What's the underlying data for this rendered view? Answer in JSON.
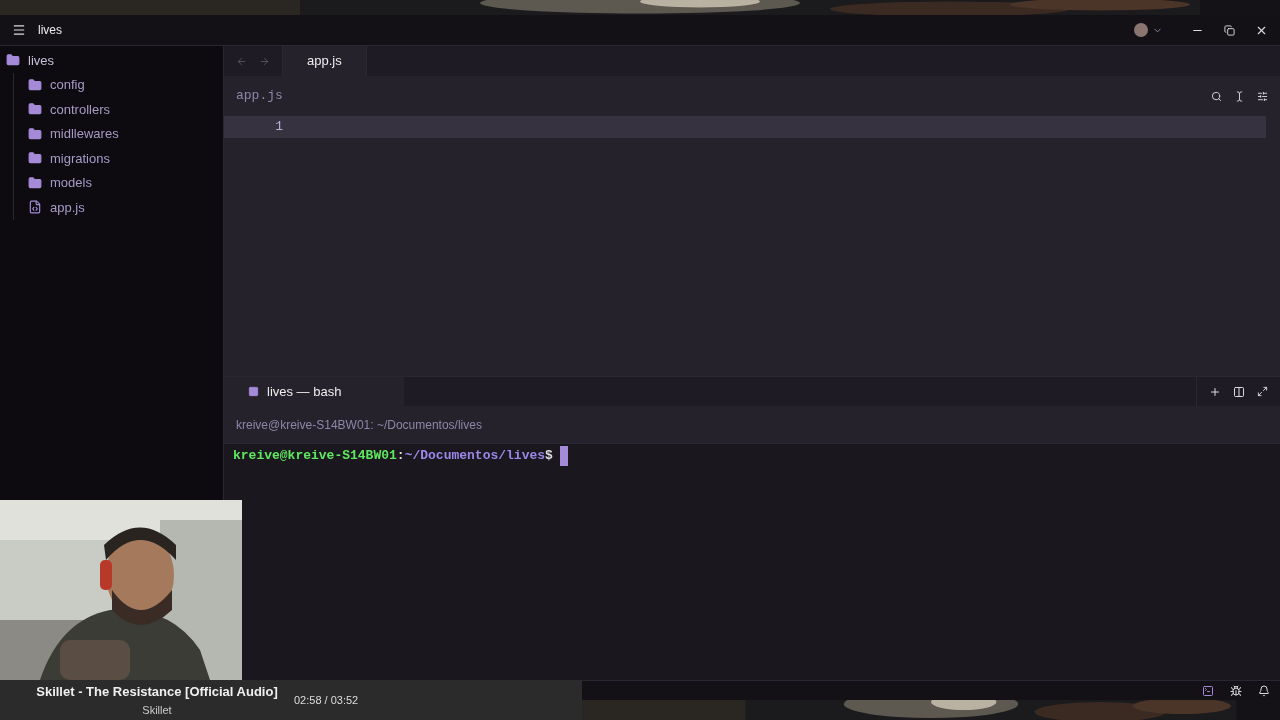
{
  "window": {
    "title": "lives"
  },
  "sidebar": {
    "tree": [
      {
        "label": "lives",
        "kind": "folder",
        "children": [
          {
            "label": "config",
            "kind": "folder"
          },
          {
            "label": "controllers",
            "kind": "folder"
          },
          {
            "label": "midllewares",
            "kind": "folder"
          },
          {
            "label": "migrations",
            "kind": "folder"
          },
          {
            "label": "models",
            "kind": "folder"
          },
          {
            "label": "app.js",
            "kind": "file"
          }
        ]
      }
    ]
  },
  "editor": {
    "tabs": [
      {
        "label": "app.js",
        "selected": true
      }
    ],
    "breadcrumb": "app.js",
    "line_numbers": [
      "1"
    ]
  },
  "terminal": {
    "tabs": [
      {
        "label": "lives — bash",
        "selected": true
      }
    ],
    "title": "kreive@kreive-S14BW01: ~/Documentos/lives",
    "prompt": {
      "user_host": "kreive@kreive-S14BW01",
      "separator": ":",
      "path": "~/Documentos/lives",
      "symbol": "$"
    }
  },
  "media": {
    "title": "Skillet - The Resistance [Official Audio]",
    "artist": "Skillet",
    "time": "02:58 / 03:52"
  }
}
